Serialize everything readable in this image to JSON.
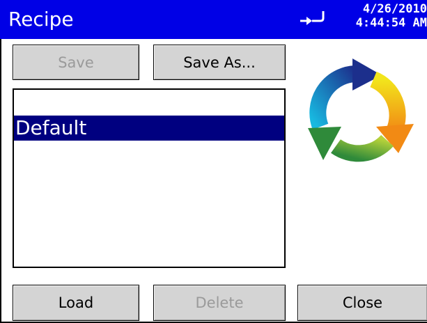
{
  "window": {
    "title": "Recipe",
    "date": "4/26/2010",
    "time": "4:44:54 AM"
  },
  "toolbar": {
    "save_label": "Save",
    "save_as_label": "Save As..."
  },
  "recipes": {
    "items": [
      {
        "name": "Default",
        "selected": true
      }
    ]
  },
  "footer": {
    "load_label": "Load",
    "delete_label": "Delete",
    "close_label": "Close"
  },
  "icons": {
    "status": "plug-icon",
    "logo": "cycle-arrows-icon"
  },
  "colors": {
    "titlebar": "#0000e6",
    "selection": "#000080",
    "button_face": "#d4d4d4",
    "disabled_text": "#9a9a9a"
  }
}
